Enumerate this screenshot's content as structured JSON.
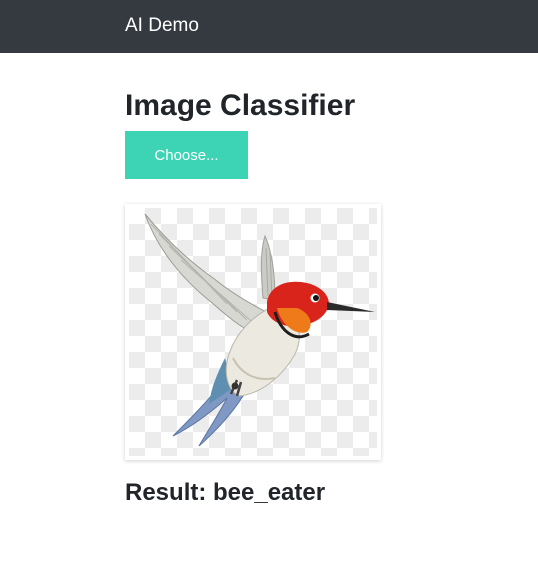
{
  "navbar": {
    "brand": "AI Demo"
  },
  "main": {
    "title": "Image Classifier",
    "choose_button_label": "Choose...",
    "result_text": "Result: bee_eater"
  },
  "colors": {
    "navbar_bg": "#343a40",
    "button_bg": "#3dd4b5",
    "text": "#212529"
  },
  "icons": {
    "uploaded_image": "bird-illustration"
  }
}
